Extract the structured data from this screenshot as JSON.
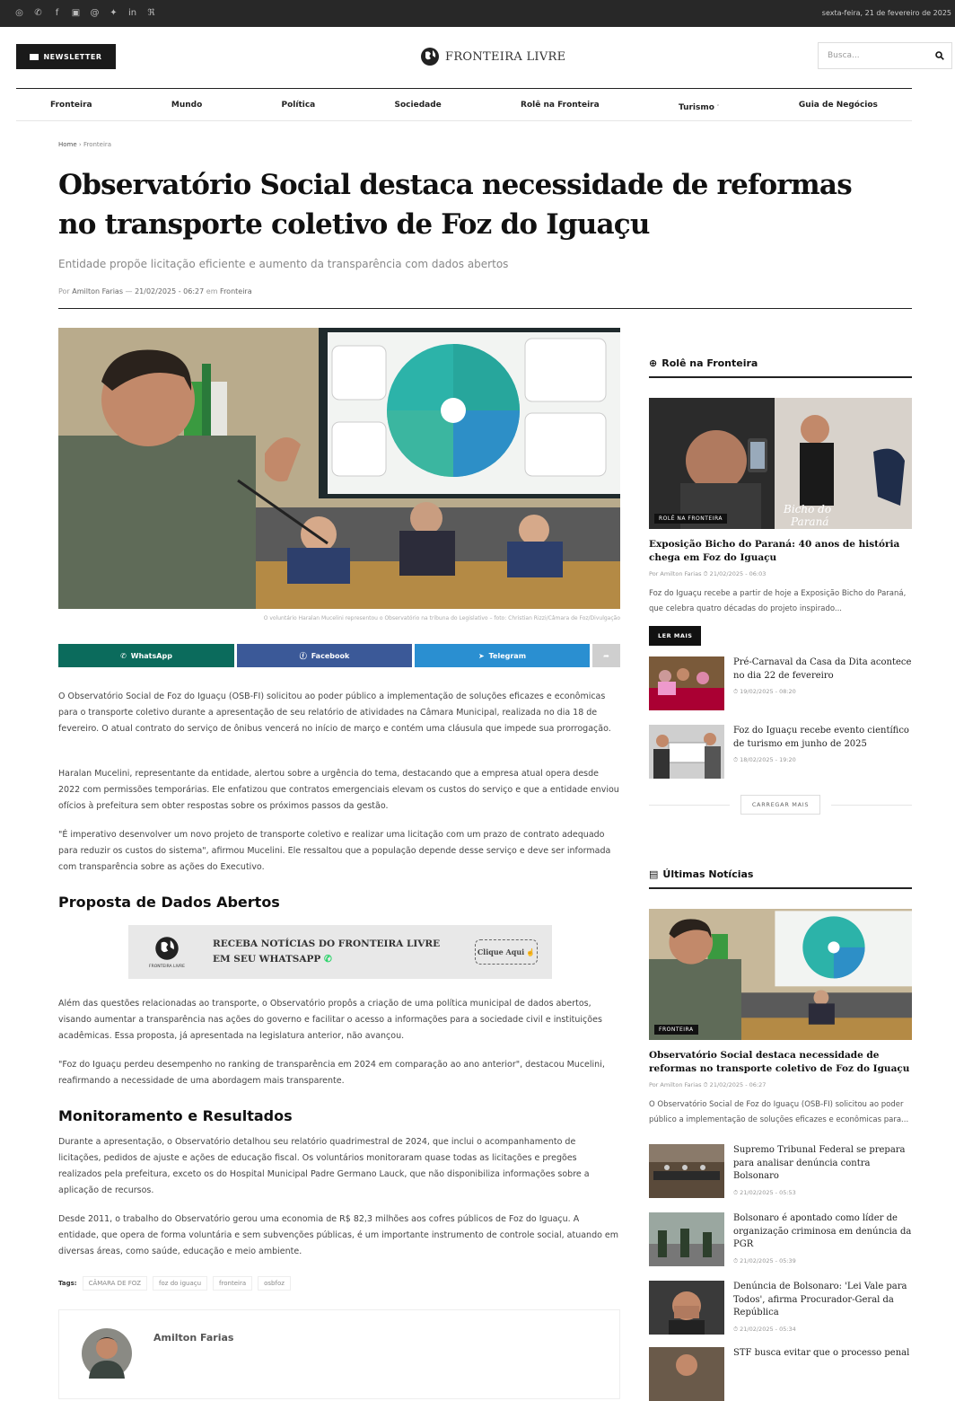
{
  "topbar": {
    "social_icons": [
      "instagram-icon",
      "whatsapp-icon",
      "facebook-icon",
      "youtube-icon",
      "threads-icon",
      "twitter-icon",
      "linkedin-icon",
      "rss-icon"
    ],
    "date": "sexta-feira, 21 de fevereiro de 2025"
  },
  "header": {
    "newsletter": "NEWSLETTER",
    "logo": "FRONTEIRA LIVRE",
    "search_placeholder": "Busca..."
  },
  "nav": [
    "Fronteira",
    "Mundo",
    "Política",
    "Sociedade",
    "Rolê na Fronteira",
    "Turismo",
    "Guia de Negócios"
  ],
  "breadcrumb": {
    "home": "Home",
    "sep": "›",
    "section": "Fronteira"
  },
  "article": {
    "title": "Observatório Social destaca necessidade de reformas no transporte coletivo de Foz do Iguaçu",
    "subtitle": "Entidade propõe licitação eficiente e aumento da transparência com dados abertos",
    "author_prefix": "Por",
    "author": "Amilton Farias",
    "date": "21/02/2025 - 06:27",
    "in": "em",
    "category": "Fronteira",
    "caption": "O voluntário Haralan Mucelini representou o Observatório na tribuna do Legislativo – foto: Christian Rizzi/Câmara de Foz/Divulgação",
    "share": {
      "whatsapp": "WhatsApp",
      "facebook": "Facebook",
      "telegram": "Telegram"
    },
    "p1": "O Observatório Social de Foz do Iguaçu (OSB-FI) solicitou ao poder público a implementação de soluções eficazes e econômicas para o transporte coletivo durante a apresentação de seu relatório de atividades na Câmara Municipal, realizada no dia 18 de fevereiro. O atual contrato do serviço de ônibus vencerá no início de março e contém uma cláusula que impede sua prorrogação.",
    "p2": "Haralan Mucelini, representante da entidade, alertou sobre a urgência do tema, destacando que a empresa atual opera desde 2022 com permissões temporárias. Ele enfatizou que contratos emergenciais elevam os custos do serviço e que a entidade enviou ofícios à prefeitura sem obter respostas sobre os próximos passos da gestão.",
    "p3": "\"É imperativo desenvolver um novo projeto de transporte coletivo e realizar uma licitação com um prazo de contrato adequado para reduzir os custos do sistema\", afirmou Mucelini. Ele ressaltou que a população depende desse serviço e deve ser informada com transparência sobre as ações do Executivo.",
    "h2a": "Proposta de Dados Abertos",
    "banner_line1": "RECEBA NOTÍCIAS DO FRONTEIRA LIVRE",
    "banner_line2": "EM SEU WHATSAPP",
    "banner_btn": "Clique Aqui",
    "banner_logo": "FRONTEIRA LIVRE",
    "p4": "Além das questões relacionadas ao transporte, o Observatório propôs a criação de uma política municipal de dados abertos, visando aumentar a transparência nas ações do governo e facilitar o acesso a informações para a sociedade civil e instituições acadêmicas. Essa proposta, já apresentada na legislatura anterior, não avançou.",
    "p5": "\"Foz do Iguaçu perdeu desempenho no ranking de transparência em 2024 em comparação ao ano anterior\", destacou Mucelini, reafirmando a necessidade de uma abordagem mais transparente.",
    "h2b": "Monitoramento e Resultados",
    "p6": "Durante a apresentação, o Observatório detalhou seu relatório quadrimestral de 2024, que inclui o acompanhamento de licitações, pedidos de ajuste e ações de educação fiscal. Os voluntários monitoraram quase todas as licitações e pregões realizados pela prefeitura, exceto os do Hospital Municipal Padre Germano Lauck, que não disponibiliza informações sobre a aplicação de recursos.",
    "p7": "Desde 2011, o trabalho do Observatório gerou uma economia de R$ 82,3 milhões aos cofres públicos de Foz do Iguaçu. A entidade, que opera de forma voluntária e sem subvenções públicas, é um importante instrumento de controle social, atuando em diversas áreas, como saúde, educação e meio ambiente.",
    "tags_label": "Tags:",
    "tags": [
      "CÂMARA DE FOZ",
      "foz do iguaçu",
      "fronteira",
      "osbfoz"
    ],
    "author_box": "Amilton Farias"
  },
  "sidebar1": {
    "heading": "Rolê na Fronteira",
    "featured_label": "ROLÊ NA FRONTEIRA",
    "featured_title": "Exposição Bicho do Paraná: 40 anos de história chega em Foz do Iguaçu",
    "featured_meta": "Por Amilton Farias  ⏱ 21/02/2025 - 06:03",
    "featured_excerpt": "Foz do Iguaçu recebe a partir de hoje a Exposição Bicho do Paraná, que celebra quatro décadas do projeto inspirado...",
    "read_more": "LER MAIS",
    "items": [
      {
        "title": "Pré-Carnaval da Casa da Dita acontece no dia 22 de fevereiro",
        "date": "⏱ 19/02/2025 - 08:20"
      },
      {
        "title": "Foz do Iguaçu recebe evento científico de turismo em junho de 2025",
        "date": "⏱ 18/02/2025 - 19:20"
      }
    ],
    "load_more": "CARREGAR MAIS"
  },
  "sidebar2": {
    "heading": "Últimas Notícias",
    "featured_label": "FRONTEIRA",
    "featured_title": "Observatório Social destaca necessidade de reformas no transporte coletivo de Foz do Iguaçu",
    "featured_meta": "Por Amilton Farias  ⏱ 21/02/2025 - 06:27",
    "featured_excerpt": "O Observatório Social de Foz do Iguaçu (OSB-FI) solicitou ao poder público a implementação de soluções eficazes e econômicas para...",
    "items": [
      {
        "title": "Supremo Tribunal Federal se prepara para analisar denúncia contra Bolsonaro",
        "date": "⏱ 21/02/2025 - 05:53"
      },
      {
        "title": "Bolsonaro é apontado como líder de organização criminosa em denúncia da PGR",
        "date": "⏱ 21/02/2025 - 05:39"
      },
      {
        "title": "Denúncia de Bolsonaro: 'Lei Vale para Todos', afirma Procurador-Geral da República",
        "date": "⏱ 21/02/2025 - 05:34"
      },
      {
        "title": "STF busca evitar que o processo penal",
        "date": ""
      }
    ]
  },
  "colors": {
    "whatsapp": "#0b6b5c",
    "facebook": "#3b5998",
    "telegram": "#2a8fd1",
    "share_more": "#cfcfcf",
    "topbar": "#282828"
  }
}
